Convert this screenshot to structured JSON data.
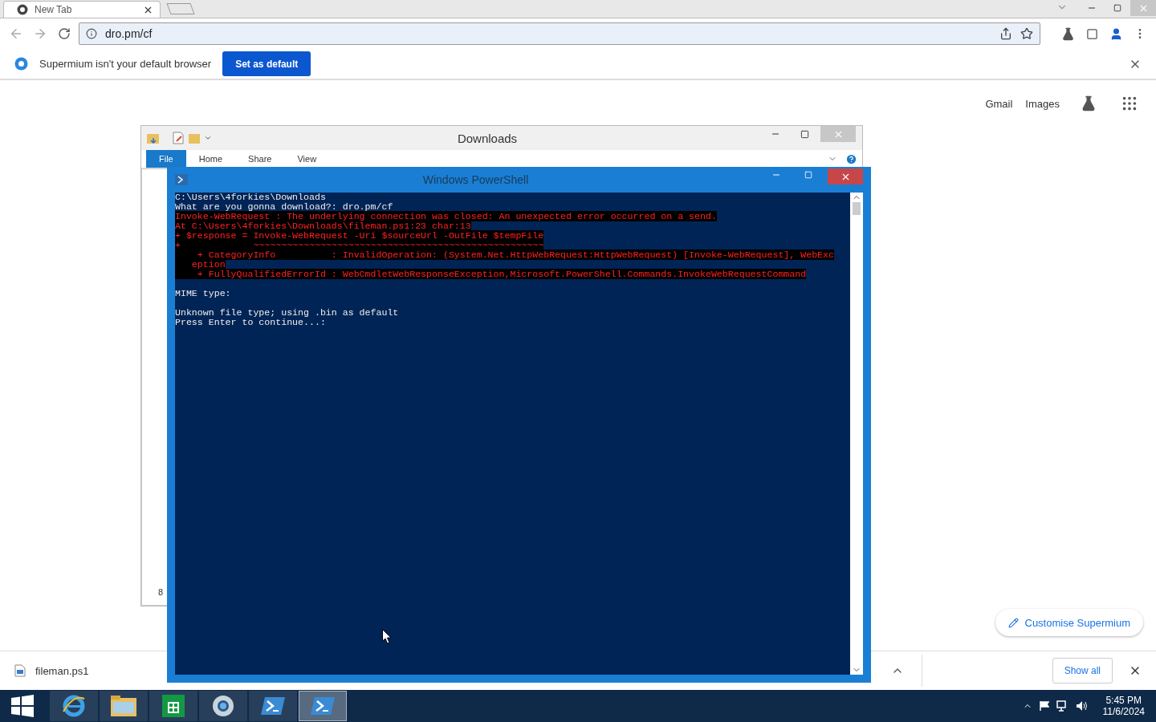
{
  "browser": {
    "tab": {
      "title": "New Tab"
    },
    "address": "dro.pm/cf",
    "infobar": {
      "message": "Supermium isn't your default browser",
      "button": "Set as default"
    },
    "links": [
      "Gmail",
      "Images"
    ],
    "customise": "Customise Supermium",
    "downloads": {
      "file": "fileman.ps1",
      "show_all": "Show all"
    }
  },
  "explorer": {
    "title": "Downloads",
    "ribbon_tabs": [
      {
        "label": "File",
        "selected": true
      },
      {
        "label": "Home",
        "selected": false
      },
      {
        "label": "Share",
        "selected": false
      },
      {
        "label": "View",
        "selected": false
      }
    ],
    "status": "8"
  },
  "powershell": {
    "title": "Windows PowerShell",
    "lines": [
      {
        "kind": "output",
        "text": "C:\\Users\\4forkies\\Downloads"
      },
      {
        "kind": "output",
        "text": "What are you gonna download?: dro.pm/cf"
      },
      {
        "kind": "error",
        "text": "Invoke-WebRequest : The underlying connection was closed: An unexpected error occurred on a send."
      },
      {
        "kind": "error",
        "text": "At C:\\Users\\4forkies\\Downloads\\fileman.ps1:23 char:13"
      },
      {
        "kind": "error",
        "text": "+ $response = Invoke-WebRequest -Uri $sourceUrl -OutFile $tempFile"
      },
      {
        "kind": "error",
        "text": "+             ~~~~~~~~~~~~~~~~~~~~~~~~~~~~~~~~~~~~~~~~~~~~~~~~~~~~"
      },
      {
        "kind": "error",
        "text": "    + CategoryInfo          : InvalidOperation: (System.Net.HttpWebRequest:HttpWebRequest) [Invoke-WebRequest], WebExc"
      },
      {
        "kind": "error",
        "text": "   eption"
      },
      {
        "kind": "error",
        "text": "    + FullyQualifiedErrorId : WebCmdletWebResponseException,Microsoft.PowerShell.Commands.InvokeWebRequestCommand"
      },
      {
        "kind": "blank"
      },
      {
        "kind": "output",
        "text": "MIME type:"
      },
      {
        "kind": "blank"
      },
      {
        "kind": "output",
        "text": "Unknown file type; using .bin as default"
      },
      {
        "kind": "output",
        "text": "Press Enter to continue...:"
      }
    ]
  },
  "taskbar": {
    "apps": [
      {
        "kind": "ie",
        "selected": false
      },
      {
        "kind": "folder",
        "selected": false
      },
      {
        "kind": "store",
        "selected": false
      },
      {
        "kind": "browser",
        "selected": false
      },
      {
        "kind": "shell",
        "selected": false
      },
      {
        "kind": "shell",
        "selected": true
      }
    ],
    "time": "5:45 PM",
    "date": "11/6/2024"
  }
}
